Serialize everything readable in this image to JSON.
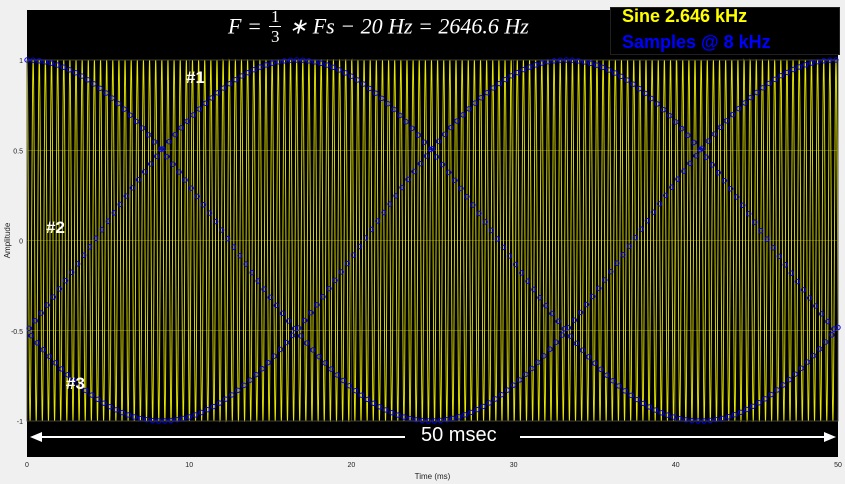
{
  "chart_data": {
    "type": "line",
    "title": "",
    "xlabel": "Time (ms)",
    "ylabel": "Amplitude",
    "xlim": [
      0,
      50
    ],
    "ylim": [
      -1,
      1
    ],
    "x_ticks": [
      0,
      10,
      20,
      30,
      40,
      50
    ],
    "y_ticks": [
      -1,
      -0.5,
      0,
      0.5,
      1
    ],
    "y_tick_labels": [
      "-1",
      "-0.5",
      "0",
      "0.5",
      "1"
    ],
    "grid": true,
    "legend": {
      "entries": [
        "Sine 2.646 kHz",
        "Samples @ 8 kHz"
      ],
      "placement": "top-right"
    },
    "signal_frequency_hz": 2646.6,
    "sample_rate_hz": 8000,
    "series": [
      {
        "name": "Sine 2.646 kHz",
        "kind": "continuous sine",
        "frequency_hz": 2646.6,
        "amplitude": 1
      },
      {
        "name": "Samples @ 8 kHz",
        "kind": "samples",
        "sample_rate_hz": 8000
      }
    ],
    "sample_envelope_curves": [
      {
        "label": "#1",
        "x": [
          0,
          4.1,
          12.4,
          20.8,
          29.1,
          37.5,
          45.8,
          50
        ],
        "y": [
          0.87,
          1,
          0.5,
          1,
          0.5,
          1,
          0.5,
          0.87
        ]
      },
      {
        "label": "#2",
        "x": [
          0,
          4.1,
          12.4,
          20.8,
          29.1,
          37.5,
          45.8,
          50
        ],
        "y": [
          0,
          -0.5,
          0.5,
          -0.5,
          0.5,
          -0.5,
          0.5,
          0
        ]
      },
      {
        "label": "#3",
        "x": [
          0,
          4.1,
          12.4,
          20.8,
          29.1,
          37.5,
          45.8,
          50
        ],
        "y": [
          -0.87,
          -0.5,
          -1,
          -0.5,
          -1,
          -0.5,
          -1,
          -0.87
        ]
      }
    ],
    "annotations": {
      "formula": {
        "lhs": "F =",
        "num": "1",
        "den": "3",
        "rhs": "∗ Fs − 20 Hz = 2646.6 Hz"
      },
      "duration": "50 msec"
    }
  },
  "colors": {
    "signal": "#ffff00",
    "samples": "#0000ff",
    "plot_bg": "#000000",
    "grid": "#c8c84a"
  }
}
